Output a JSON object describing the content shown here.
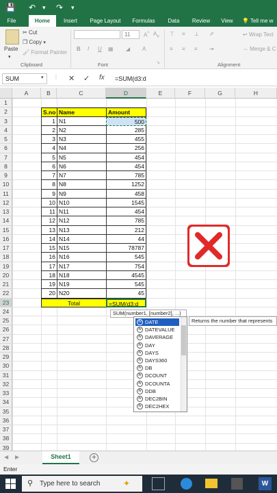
{
  "app": {
    "accent": "#217346"
  },
  "ribbon": {
    "tabs": [
      "File",
      "Home",
      "Insert",
      "Page Layout",
      "Formulas",
      "Data",
      "Review",
      "View",
      "Tell me w"
    ],
    "clipboard": {
      "paste": "Paste",
      "cut": "Cut",
      "copy": "Copy",
      "format_painter": "Format Painter",
      "group": "Clipboard"
    },
    "font": {
      "size": "11",
      "bold": "B",
      "italic": "I",
      "underline": "U",
      "group": "Font"
    },
    "alignment": {
      "wrap": "Wrap Text",
      "merge": "Merge & C",
      "group": "Alignment"
    }
  },
  "formula_bar": {
    "name_box": "SUM",
    "fx": "fx",
    "cancel": "✕",
    "enter": "✓",
    "value": "=SUM(d3:d"
  },
  "columns": [
    "A",
    "B",
    "C",
    "D",
    "E",
    "F",
    "G",
    "H"
  ],
  "rows": [
    "1",
    "2",
    "3",
    "4",
    "5",
    "6",
    "7",
    "8",
    "9",
    "10",
    "11",
    "12",
    "13",
    "14",
    "15",
    "16",
    "17",
    "18",
    "19",
    "20",
    "21",
    "22",
    "23",
    "24",
    "25",
    "26",
    "27",
    "28",
    "29",
    "30",
    "31",
    "32",
    "33",
    "34",
    "35",
    "36",
    "37",
    "38",
    "39"
  ],
  "table": {
    "headers": [
      "S.no",
      "Name",
      "Amount"
    ],
    "rows": [
      [
        "1",
        "N1",
        "500"
      ],
      [
        "2",
        "N2",
        "285"
      ],
      [
        "3",
        "N3",
        "455"
      ],
      [
        "4",
        "N4",
        "256"
      ],
      [
        "5",
        "N5",
        "454"
      ],
      [
        "6",
        "N6",
        "454"
      ],
      [
        "7",
        "N7",
        "785"
      ],
      [
        "8",
        "N8",
        "1252"
      ],
      [
        "9",
        "N9",
        "458"
      ],
      [
        "10",
        "N10",
        "1545"
      ],
      [
        "11",
        "N11",
        "454"
      ],
      [
        "12",
        "N12",
        "785"
      ],
      [
        "13",
        "N13",
        "212"
      ],
      [
        "14",
        "N14",
        "44"
      ],
      [
        "15",
        "N15",
        "78787"
      ],
      [
        "16",
        "N16",
        "545"
      ],
      [
        "17",
        "N17",
        "754"
      ],
      [
        "18",
        "N18",
        "4545"
      ],
      [
        "19",
        "N19",
        "545"
      ],
      [
        "20",
        "N20",
        "45"
      ]
    ],
    "total_label": "Total",
    "total_formula": "=SUM(d3:d"
  },
  "autocomplete": {
    "tooltip": "SUM(number1, [number2], ...)",
    "description": "Returns the number that represents",
    "items": [
      "DATE",
      "DATEVALUE",
      "DAVERAGE",
      "DAY",
      "DAYS",
      "DAYS360",
      "DB",
      "DCOUNT",
      "DCOUNTA",
      "DDB",
      "DEC2BIN",
      "DEC2HEX"
    ],
    "selected": 0
  },
  "sheets": {
    "tabs": [
      "Sheet1"
    ],
    "add": "+"
  },
  "status": {
    "mode": "Enter"
  },
  "taskbar": {
    "search_placeholder": "Type here to search"
  }
}
